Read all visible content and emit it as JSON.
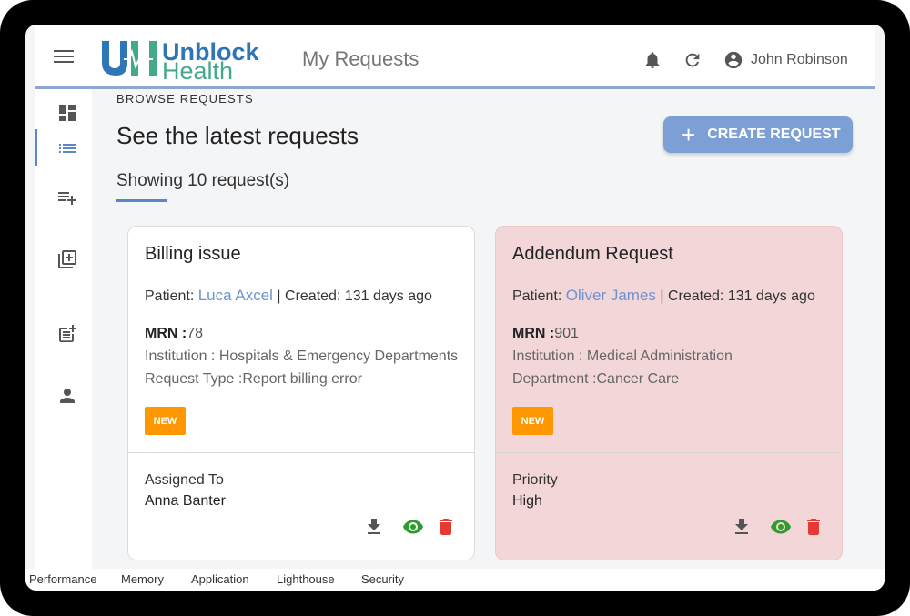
{
  "app": {
    "logo_line1": "Unblock",
    "logo_line2": "Health",
    "page_title": "My Requests",
    "user_name": "John Robinson"
  },
  "sidebar": {
    "items": [
      {
        "icon": "dashboard-icon"
      },
      {
        "icon": "list-icon",
        "active": true
      },
      {
        "icon": "playlist-add-icon"
      },
      {
        "icon": "library-add-icon"
      },
      {
        "icon": "post-add-icon"
      },
      {
        "icon": "person-icon"
      }
    ]
  },
  "main": {
    "overline": "BROWSE REQUESTS",
    "heading": "See the latest requests",
    "showing": "Showing 10 request(s)",
    "create_button": "CREATE REQUEST"
  },
  "cards": [
    {
      "title": "Billing issue",
      "patient_label": "Patient:",
      "patient_name": "Luca Axcel",
      "created": "| Created: 131 days ago",
      "mrn_label": "MRN :",
      "mrn_value": "78",
      "info1": "Institution : Hospitals & Emergency Departments",
      "info2": "Request Type :Report billing error",
      "badge": "NEW",
      "footer_label": "Assigned To",
      "footer_value": "Anna Banter",
      "background": "#ffffff"
    },
    {
      "title": "Addendum Request",
      "patient_label": "Patient:",
      "patient_name": "Oliver James",
      "created": "| Created: 131 days ago",
      "mrn_label": "MRN :",
      "mrn_value": "901",
      "info1": "Institution : Medical Administration",
      "info2": "Department :Cancer Care",
      "badge": "NEW",
      "footer_label": "Priority",
      "footer_value": "High",
      "background": "#f3d6d8"
    }
  ],
  "devtools_tabs": [
    "Performance",
    "Memory",
    "Application",
    "Lighthouse",
    "Security"
  ],
  "colors": {
    "accent": "#7c9fd6",
    "badge": "#ff9800",
    "view": "#2e9d2e",
    "delete": "#e53935",
    "link": "#6c94cf"
  }
}
